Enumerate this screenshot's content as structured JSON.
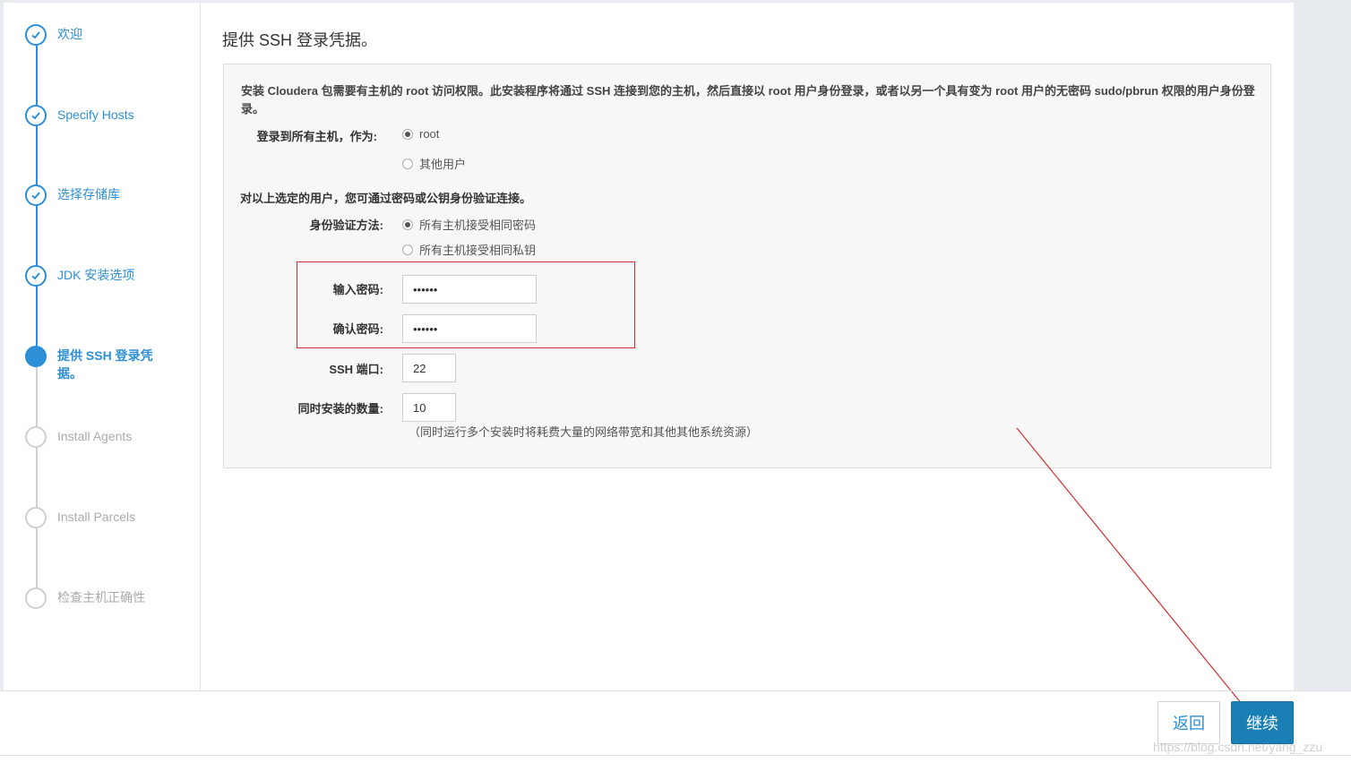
{
  "sidebar": {
    "steps": [
      {
        "label": "欢迎",
        "state": "done"
      },
      {
        "label": "Specify Hosts",
        "state": "done"
      },
      {
        "label": "选择存储库",
        "state": "done"
      },
      {
        "label": "JDK 安装选项",
        "state": "done"
      },
      {
        "label": "提供 SSH 登录凭据。",
        "state": "active"
      },
      {
        "label": "Install Agents",
        "state": "pending"
      },
      {
        "label": "Install Parcels",
        "state": "pending"
      },
      {
        "label": "检查主机正确性",
        "state": "pending"
      }
    ]
  },
  "main": {
    "title": "提供 SSH 登录凭据。",
    "description": "安装 Cloudera 包需要有主机的 root 访问权限。此安装程序将通过 SSH 连接到您的主机，然后直接以 root 用户身份登录，或者以另一个具有变为 root 用户的无密码 sudo/pbrun 权限的用户身份登录。",
    "login_label": "登录到所有主机，作为:",
    "login_options": [
      "root",
      "其他用户"
    ],
    "login_selected": "root",
    "auth_note": "对以上选定的用户，您可通过密码或公钥身份验证连接。",
    "auth_label": "身份验证方法:",
    "auth_options": [
      "所有主机接受相同密码",
      "所有主机接受相同私钥"
    ],
    "auth_selected": "所有主机接受相同密码",
    "password_label": "输入密码:",
    "password_value": "••••••",
    "confirm_label": "确认密码:",
    "confirm_value": "••••••",
    "ssh_port_label": "SSH 端口:",
    "ssh_port_value": "22",
    "concurrent_label": "同时安装的数量:",
    "concurrent_value": "10",
    "concurrent_hint": "（同时运行多个安装时将耗费大量的网络带宽和其他其他系统资源）"
  },
  "footer": {
    "back_label": "返回",
    "next_label": "继续"
  },
  "watermark": "https://blog.csdn.net/yang_zzu",
  "colors": {
    "accent": "#2d8fd5",
    "primary_button": "#1a7fb5",
    "annotation": "#d32f2f"
  }
}
